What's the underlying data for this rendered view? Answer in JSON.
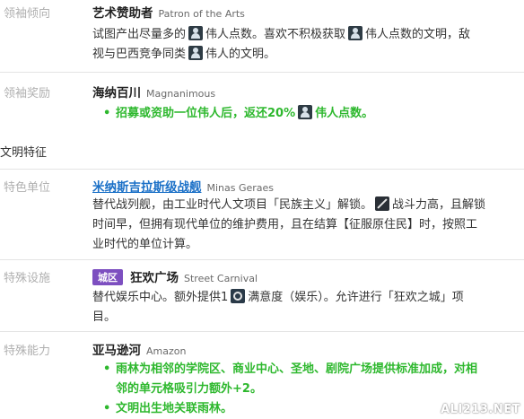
{
  "agenda": {
    "label": "领袖倾向",
    "name": "艺术赞助者",
    "name_en": "Patron of the Arts",
    "desc_line1_a": "试图产出尽量多的",
    "desc_line1_b": "伟人点数。喜欢不积极获取",
    "desc_line1_c": "伟人点数的文明，敌",
    "desc_line2_a": "视与巴西竞争同类",
    "desc_line2_b": "伟人的文明。"
  },
  "leader_ability": {
    "label": "领袖奖励",
    "name": "海纳百川",
    "name_en": "Magnanimous",
    "bullet_a": "招募或资助一位伟人后，返还20%",
    "bullet_b": "伟人点数。"
  },
  "civ_section_title": "文明特征",
  "unique_unit": {
    "label": "特色单位",
    "name": "米纳斯吉拉斯级战舰",
    "name_en": "Minas Geraes",
    "desc_line1_a": "替代战列舰，由工业时代人文项目「民族主义」解锁。",
    "desc_line1_b": "战斗力高，且解锁",
    "desc_line2": "时间早，但拥有现代单位的维护费用，且在结算【征服原住民】时，按照工",
    "desc_line3": "业时代的单位计算。"
  },
  "unique_building": {
    "label": "特殊设施",
    "badge": "城区",
    "name": "狂欢广场",
    "name_en": "Street Carnival",
    "desc_line1_a": "替代娱乐中心。额外提供1",
    "desc_line1_b": "满意度（娱乐）。允许进行「狂欢之城」项",
    "desc_line2": "目。"
  },
  "civ_ability": {
    "label": "特殊能力",
    "name": "亚马逊河",
    "name_en": "Amazon",
    "bullet1_line1": "雨林为相邻的学院区、商业中心、圣地、剧院广场提供标准加成，对相",
    "bullet1_line2": "邻的单元格吸引力额外+2。",
    "bullet2": "文明出生地关联雨林。"
  },
  "watermark": "ALI213.NET",
  "icons": [
    "great-person-icon",
    "strength-icon",
    "amenity-icon"
  ]
}
